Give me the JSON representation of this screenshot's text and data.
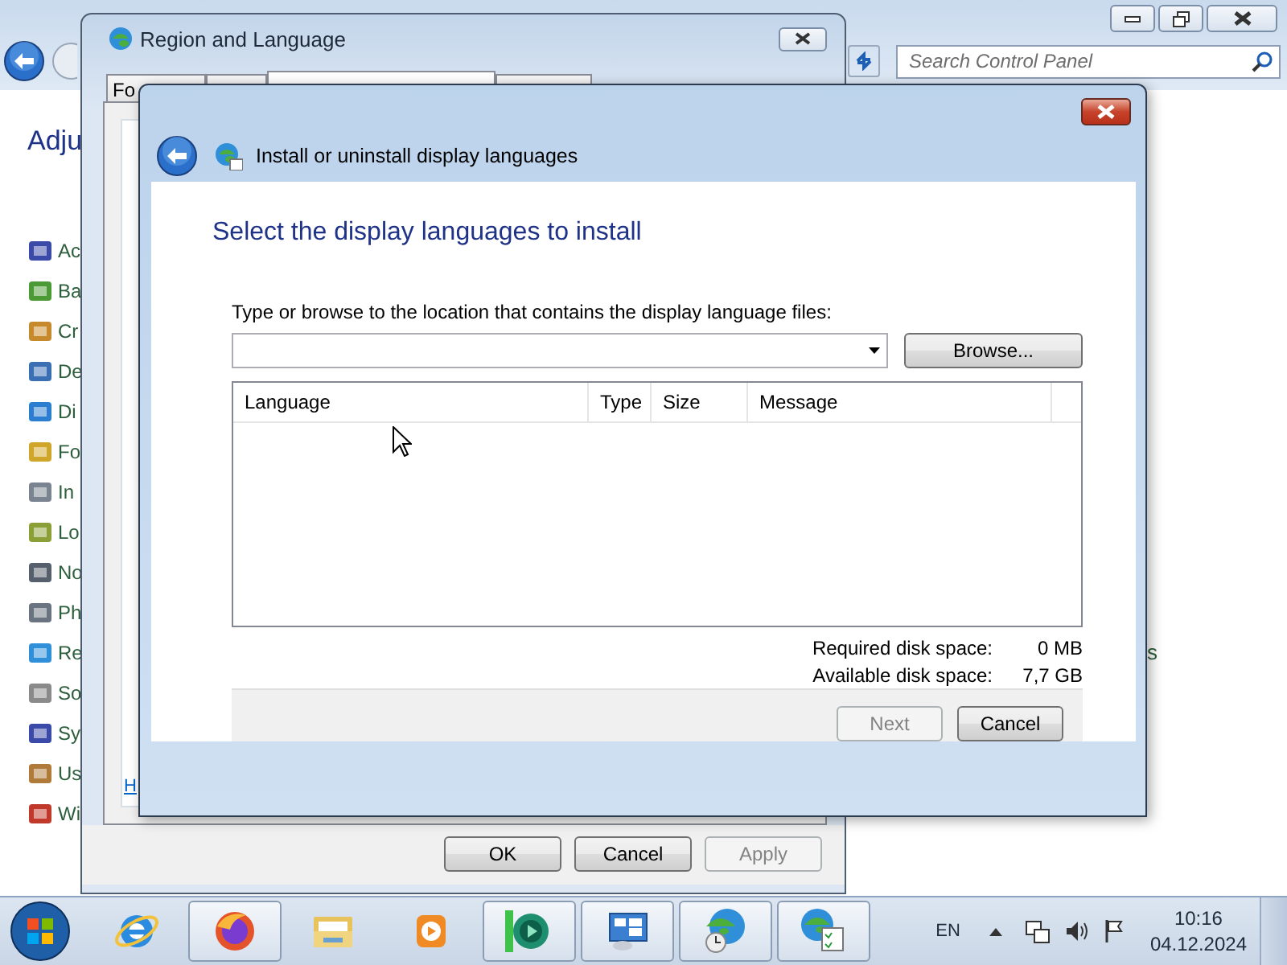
{
  "control_panel": {
    "search": {
      "placeholder": "Search Control Panel"
    },
    "heading": "Adju",
    "items": [
      "Ac",
      "Ba",
      "Cr",
      "De",
      "Di",
      "Fo",
      "In",
      "Lo",
      "No",
      "Ph",
      "Re",
      "So",
      "Sy",
      "Us",
      "Wi"
    ],
    "side_text": "s"
  },
  "region_window": {
    "title": "Region and Language",
    "tabs": [
      {
        "label": "Fo",
        "selected": false
      },
      {
        "selected": false
      },
      {
        "selected": true
      },
      {
        "selected": false
      }
    ],
    "link": "H",
    "buttons": [
      {
        "label": "OK",
        "disabled": false
      },
      {
        "label": "Cancel",
        "disabled": false
      },
      {
        "label": "Apply",
        "disabled": true
      }
    ]
  },
  "install_dialog": {
    "title": "Install or uninstall display languages",
    "heading": "Select the display languages to install",
    "location_label": "Type or browse to the location that contains the display language files:",
    "browse_button": "Browse...",
    "columns": [
      "Language",
      "Type",
      "Size",
      "Message"
    ],
    "disk": [
      {
        "label": "Required disk space:",
        "value": "0 MB"
      },
      {
        "label": "Available disk space:",
        "value": "7,7 GB"
      }
    ],
    "buttons": [
      {
        "label": "Next",
        "disabled": true
      },
      {
        "label": "Cancel",
        "disabled": false
      }
    ]
  },
  "taskbar": {
    "apps": [
      {
        "kind": "ie",
        "running": false
      },
      {
        "kind": "firefox",
        "running": true
      },
      {
        "kind": "folder",
        "running": false
      },
      {
        "kind": "media",
        "running": false
      },
      {
        "kind": "chat",
        "running": true
      },
      {
        "kind": "panel",
        "running": true
      },
      {
        "kind": "globe-clock",
        "running": true
      },
      {
        "kind": "globe-list",
        "running": true
      }
    ],
    "language": "EN",
    "time": "10:16",
    "date": "04.12.2024"
  }
}
